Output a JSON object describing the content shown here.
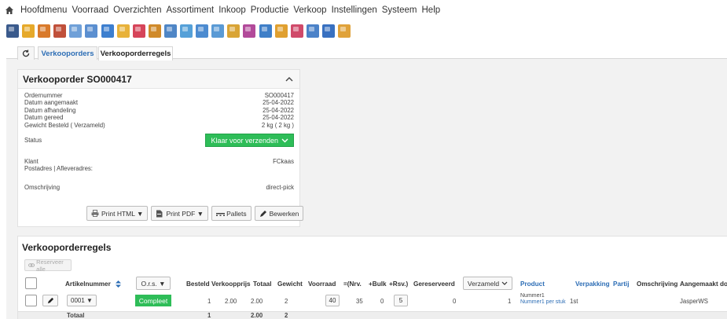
{
  "menu": {
    "items": [
      "Hoofdmenu",
      "Voorraad",
      "Overzichten",
      "Assortiment",
      "Inkoop",
      "Productie",
      "Verkoop",
      "Instellingen",
      "Systeem",
      "Help"
    ]
  },
  "toolbar": {
    "icons": [
      {
        "name": "phone-icon",
        "color": "#3a5a8c"
      },
      {
        "name": "chart-icon",
        "color": "#e6a92a"
      },
      {
        "name": "tools-icon",
        "color": "#d97a2b"
      },
      {
        "name": "calculator-icon",
        "color": "#c0503a"
      },
      {
        "name": "warehouse-icon",
        "color": "#6fa0d8"
      },
      {
        "name": "grid-icon",
        "color": "#5b8fd0"
      },
      {
        "name": "box-blue-icon",
        "color": "#3d7fcf"
      },
      {
        "name": "pen-icon",
        "color": "#e8b23a"
      },
      {
        "name": "flower-icon",
        "color": "#d6455a"
      },
      {
        "name": "truck-icon",
        "color": "#d08a2a"
      },
      {
        "name": "search-user-icon",
        "color": "#4f86c6"
      },
      {
        "name": "phone-call-icon",
        "color": "#55a0d8"
      },
      {
        "name": "cycle-icon",
        "color": "#4c8bd0"
      },
      {
        "name": "package-edit-icon",
        "color": "#5a9ad5"
      },
      {
        "name": "document-chart-icon",
        "color": "#d9a435"
      },
      {
        "name": "crates-icon",
        "color": "#b24a9a"
      },
      {
        "name": "export-icon",
        "color": "#3f7fc8"
      },
      {
        "name": "note-icon",
        "color": "#e0a030"
      },
      {
        "name": "invoice-icon",
        "color": "#d04a6a"
      },
      {
        "name": "share-icon",
        "color": "#4b82c8"
      },
      {
        "name": "users-icon",
        "color": "#3870c0"
      },
      {
        "name": "person-icon",
        "color": "#e0a23a"
      }
    ]
  },
  "tabs": {
    "refresh_icon": "refresh-icon",
    "tab1": "Verkooporders",
    "tab2": "Verkooporderregels"
  },
  "order": {
    "title": "Verkooporder SO000417",
    "fields": [
      {
        "label": "Ordernummer",
        "value": "SO000417"
      },
      {
        "label": "Datum aangemaakt",
        "value": "25-04-2022"
      },
      {
        "label": "Datum afhandeling",
        "value": "25-04-2022"
      },
      {
        "label": "Datum gereed",
        "value": "25-04-2022"
      },
      {
        "label": "Gewicht Besteld ( Verzameld)",
        "value": "2 kg ( 2 kg )"
      }
    ],
    "status_label": "Status",
    "status_value": "Klaar voor verzenden",
    "status_color": "#2ebd58",
    "klant_label": "Klant",
    "klant_value": "FCkaas",
    "address_label": "Postadres | Afleveradres:",
    "omschrijving_label": "Omschrijving",
    "omschrijving_value": "direct-pick",
    "buttons": {
      "print_html": "Print HTML ▼",
      "print_pdf": "Print PDF ▼",
      "pallets": "Pallets",
      "bewerken": "Bewerken"
    }
  },
  "lines": {
    "title": "Verkooporderregels",
    "reserve_all": "Reserveer alle",
    "headers": {
      "artikelnummer": "Artikelnummer",
      "ors": "O.r.s. ▼",
      "besteld": "Besteld",
      "verkoopprijs": "Verkoopprijs",
      "totaal": "Totaal",
      "gewicht": "Gewicht",
      "voorraad": "Voorraad",
      "nrv": "=(Nrv.",
      "bulk": "+Bulk",
      "rsv": "+Rsv.)",
      "gereserveerd": "Gereserveerd",
      "verzameld": "Verzameld",
      "product": "Product",
      "verpakking": "Verpakking",
      "partij": "Partij",
      "omschrijving": "Omschrijving",
      "aangemaakt": "Aangemaakt do"
    },
    "row": {
      "artikel": "0001 ▼",
      "ors": "Compleet",
      "besteld": "1",
      "verkoopprijs": "2.00",
      "totaal": "2.00",
      "gewicht": "2",
      "voorraad": "40",
      "nrv": "35",
      "bulk": "0",
      "rsv": "5",
      "gereserveerd": "0",
      "verzameld": "1",
      "product_line1": "Nummer1",
      "product_line2": "Nummer1 per stuk",
      "omschrijving": "1st",
      "aangemaakt": "JasperWS"
    },
    "totals": {
      "label": "Totaal",
      "besteld": "1",
      "totaal": "2.00",
      "gewicht": "2"
    }
  }
}
